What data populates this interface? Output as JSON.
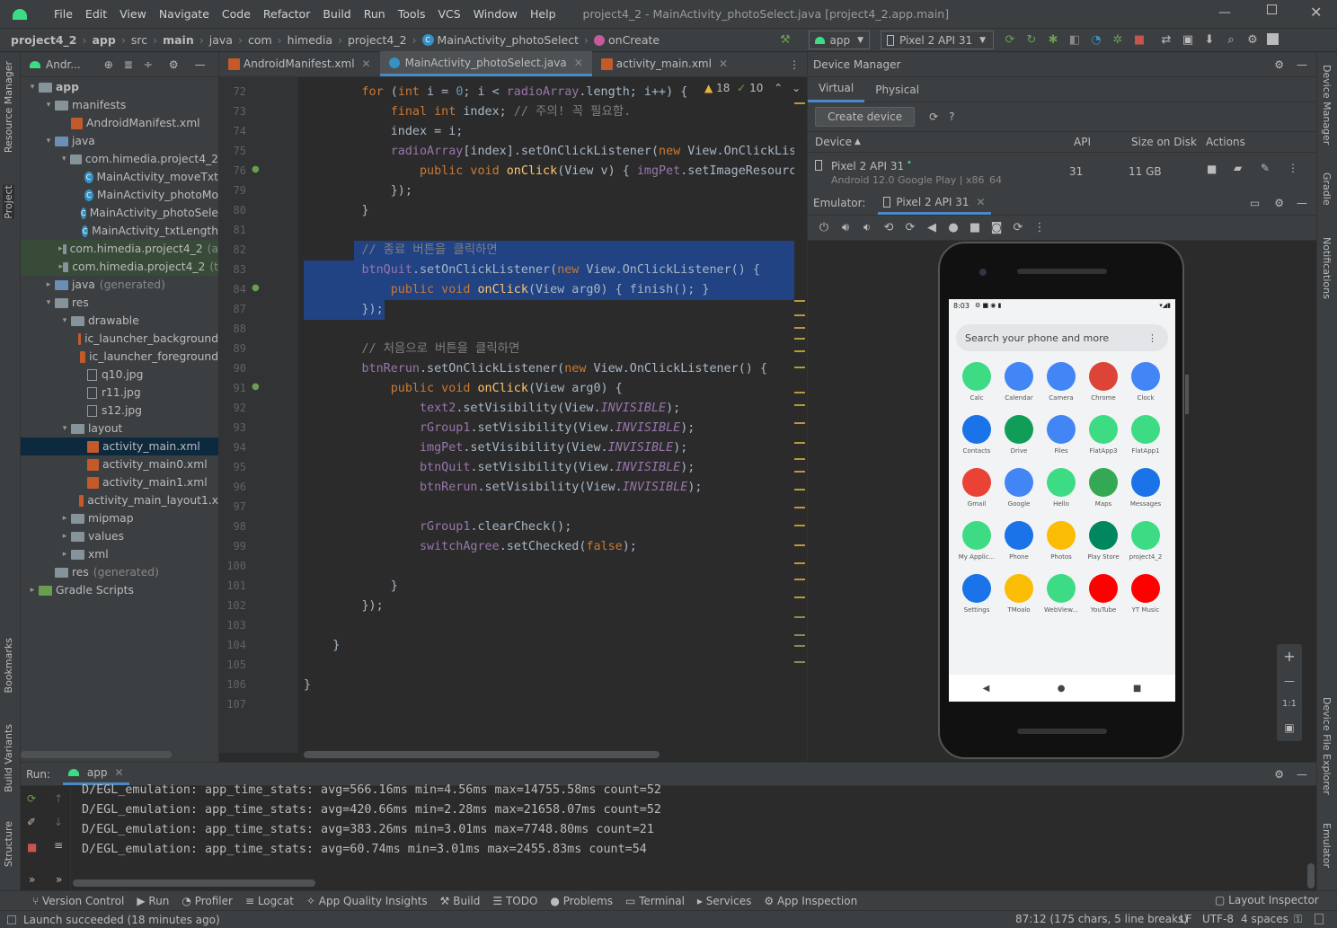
{
  "window": {
    "menu": [
      "File",
      "Edit",
      "View",
      "Navigate",
      "Code",
      "Refactor",
      "Build",
      "Run",
      "Tools",
      "VCS",
      "Window",
      "Help"
    ],
    "title": "project4_2 - MainActivity_photoSelect.java [project4_2.app.main]"
  },
  "nav": {
    "crumbs": [
      "project4_2",
      "app",
      "src",
      "main",
      "java",
      "com",
      "himedia",
      "project4_2",
      "MainActivity_photoSelect",
      "onCreate"
    ],
    "run_config": "app",
    "device": "Pixel 2 API 31"
  },
  "project": {
    "header": "Andr...",
    "tree": [
      {
        "label": "app",
        "indent": 0,
        "arrow": "▾",
        "icon": "folder",
        "bold": true
      },
      {
        "label": "manifests",
        "indent": 1,
        "arrow": "▾",
        "icon": "folder"
      },
      {
        "label": "AndroidManifest.xml",
        "indent": 2,
        "arrow": "",
        "icon": "xml"
      },
      {
        "label": "java",
        "indent": 1,
        "arrow": "▾",
        "icon": "jfolder"
      },
      {
        "label": "com.himedia.project4_2",
        "indent": 2,
        "arrow": "▾",
        "icon": "folder"
      },
      {
        "label": "MainActivity_moveTxt",
        "indent": 3,
        "arrow": "",
        "icon": "class"
      },
      {
        "label": "MainActivity_photoMo",
        "indent": 3,
        "arrow": "",
        "icon": "class"
      },
      {
        "label": "MainActivity_photoSele",
        "indent": 3,
        "arrow": "",
        "icon": "class"
      },
      {
        "label": "MainActivity_txtLength",
        "indent": 3,
        "arrow": "",
        "icon": "class"
      },
      {
        "label": "com.himedia.project4_2",
        "indent": 2,
        "arrow": "▸",
        "icon": "folder",
        "hl": true,
        "suffix": "(a"
      },
      {
        "label": "com.himedia.project4_2",
        "indent": 2,
        "arrow": "▸",
        "icon": "folder",
        "hl": true,
        "suffix": "(t"
      },
      {
        "label": "java",
        "indent": 1,
        "arrow": "▸",
        "icon": "jfolder",
        "suffix": "(generated)"
      },
      {
        "label": "res",
        "indent": 1,
        "arrow": "▾",
        "icon": "folder"
      },
      {
        "label": "drawable",
        "indent": 2,
        "arrow": "▾",
        "icon": "folder"
      },
      {
        "label": "ic_launcher_background",
        "indent": 3,
        "arrow": "",
        "icon": "xml"
      },
      {
        "label": "ic_launcher_foreground",
        "indent": 3,
        "arrow": "",
        "icon": "xml"
      },
      {
        "label": "q10.jpg",
        "indent": 3,
        "arrow": "",
        "icon": "img"
      },
      {
        "label": "r11.jpg",
        "indent": 3,
        "arrow": "",
        "icon": "img"
      },
      {
        "label": "s12.jpg",
        "indent": 3,
        "arrow": "",
        "icon": "img"
      },
      {
        "label": "layout",
        "indent": 2,
        "arrow": "▾",
        "icon": "folder"
      },
      {
        "label": "activity_main.xml",
        "indent": 3,
        "arrow": "",
        "icon": "xml",
        "selected": true
      },
      {
        "label": "activity_main0.xml",
        "indent": 3,
        "arrow": "",
        "icon": "xml"
      },
      {
        "label": "activity_main1.xml",
        "indent": 3,
        "arrow": "",
        "icon": "xml"
      },
      {
        "label": "activity_main_layout1.x",
        "indent": 3,
        "arrow": "",
        "icon": "xml"
      },
      {
        "label": "mipmap",
        "indent": 2,
        "arrow": "▸",
        "icon": "folder"
      },
      {
        "label": "values",
        "indent": 2,
        "arrow": "▸",
        "icon": "folder"
      },
      {
        "label": "xml",
        "indent": 2,
        "arrow": "▸",
        "icon": "folder"
      },
      {
        "label": "res",
        "indent": 1,
        "arrow": "",
        "icon": "folder",
        "suffix": "(generated)"
      },
      {
        "label": "Gradle Scripts",
        "indent": 0,
        "arrow": "▸",
        "icon": "gradle"
      }
    ]
  },
  "editor": {
    "tabs": [
      "AndroidManifest.xml",
      "MainActivity_photoSelect.java",
      "activity_main.xml"
    ],
    "active_tab": 1,
    "warnings": "18",
    "weak": "10",
    "lines": [
      {
        "n": "72",
        "html": "        <span class='kw'>for</span> (<span class='kw'>int</span> i = <span class='num'>0</span>; i &lt; <span class='fld'>radioArray</span>.length; i++) {"
      },
      {
        "n": "73",
        "html": "            <span class='kw'>final int</span> index; <span class='cm'>// 주의! 꼭 필요함.</span>"
      },
      {
        "n": "74",
        "html": "            index = i;"
      },
      {
        "n": "75",
        "html": "            <span class='fld'>radioArray</span>[index].setOnClickListener(<span class='kw'>new</span> View.OnClickListe"
      },
      {
        "n": "76",
        "html": "                <span class='kw'>public void</span> <span class='fn'>onClick</span>(View v) { <span class='fld'>imgPet</span>.setImageResource("
      },
      {
        "n": "79",
        "html": "            });"
      },
      {
        "n": "80",
        "html": "        }"
      },
      {
        "n": "81",
        "html": ""
      },
      {
        "n": "82",
        "html": "        <span class='cm'>// 종료 버튼을 클릭하면</span>"
      },
      {
        "n": "83",
        "html": "        <span class='fld'>btnQuit</span>.setOnClickListener(<span class='kw'>new</span> View.OnClickListener() {"
      },
      {
        "n": "84",
        "html": "            <span class='kw'>public void</span> <span class='fn'>onClick</span>(View arg0) { finish(); }"
      },
      {
        "n": "87",
        "html": "        });"
      },
      {
        "n": "88",
        "html": ""
      },
      {
        "n": "89",
        "html": "        <span class='cm'>// 처음으로 버튼을 클릭하면</span>"
      },
      {
        "n": "90",
        "html": "        <span class='fld'>btnRerun</span>.setOnClickListener(<span class='kw'>new</span> View.OnClickListener() {"
      },
      {
        "n": "91",
        "html": "            <span class='kw'>public void</span> <span class='fn'>onClick</span>(View arg0) {"
      },
      {
        "n": "92",
        "html": "                <span class='fld'>text2</span>.setVisibility(View.<span class='it'>INVISIBLE</span>);"
      },
      {
        "n": "93",
        "html": "                <span class='fld'>rGroup1</span>.setVisibility(View.<span class='it'>INVISIBLE</span>);"
      },
      {
        "n": "94",
        "html": "                <span class='fld'>imgPet</span>.setVisibility(View.<span class='it'>INVISIBLE</span>);"
      },
      {
        "n": "95",
        "html": "                <span class='fld'>btnQuit</span>.setVisibility(View.<span class='it'>INVISIBLE</span>);"
      },
      {
        "n": "96",
        "html": "                <span class='fld'>btnRerun</span>.setVisibility(View.<span class='it'>INVISIBLE</span>);"
      },
      {
        "n": "97",
        "html": ""
      },
      {
        "n": "98",
        "html": "                <span class='fld'>rGroup1</span>.clearCheck();"
      },
      {
        "n": "99",
        "html": "                <span class='fld'>switchAgree</span>.setChecked(<span class='kw'>false</span>);"
      },
      {
        "n": "100",
        "html": ""
      },
      {
        "n": "101",
        "html": "            }"
      },
      {
        "n": "102",
        "html": "        });"
      },
      {
        "n": "103",
        "html": ""
      },
      {
        "n": "104",
        "html": "    }"
      },
      {
        "n": "105",
        "html": ""
      },
      {
        "n": "106",
        "html": "}"
      },
      {
        "n": "107",
        "html": ""
      }
    ]
  },
  "device_manager": {
    "title": "Device Manager",
    "tabs": [
      "Virtual",
      "Physical"
    ],
    "create": "Create device",
    "cols": [
      "Device",
      "API",
      "Size on Disk",
      "Actions"
    ],
    "row": {
      "name": "Pixel 2 API 31",
      "sub": "Android 12.0 Google Play | x86_64",
      "api": "31",
      "size": "11 GB"
    }
  },
  "emulator": {
    "label": "Emulator:",
    "tab": "Pixel 2 API 31",
    "time": "8:03",
    "search": "Search your phone and more",
    "zoom_label": "1:1",
    "apps": [
      {
        "n": "Calc",
        "c": "#3ddc84"
      },
      {
        "n": "Calendar",
        "c": "#4285f4"
      },
      {
        "n": "Camera",
        "c": "#4285f4"
      },
      {
        "n": "Chrome",
        "c": "#db4437"
      },
      {
        "n": "Clock",
        "c": "#4285f4"
      },
      {
        "n": "Contacts",
        "c": "#1a73e8"
      },
      {
        "n": "Drive",
        "c": "#0f9d58"
      },
      {
        "n": "Files",
        "c": "#4285f4"
      },
      {
        "n": "FlatApp3",
        "c": "#3ddc84"
      },
      {
        "n": "FlatApp1",
        "c": "#3ddc84"
      },
      {
        "n": "Gmail",
        "c": "#ea4335"
      },
      {
        "n": "Google",
        "c": "#4285f4"
      },
      {
        "n": "Hello",
        "c": "#3ddc84"
      },
      {
        "n": "Maps",
        "c": "#34a853"
      },
      {
        "n": "Messages",
        "c": "#1a73e8"
      },
      {
        "n": "My Applic...",
        "c": "#3ddc84"
      },
      {
        "n": "Phone",
        "c": "#1a73e8"
      },
      {
        "n": "Photos",
        "c": "#fbbc04"
      },
      {
        "n": "Play Store",
        "c": "#01875f"
      },
      {
        "n": "project4_2",
        "c": "#3ddc84"
      },
      {
        "n": "Settings",
        "c": "#1a73e8"
      },
      {
        "n": "TMoalo",
        "c": "#fbbc04"
      },
      {
        "n": "WebView...",
        "c": "#3ddc84"
      },
      {
        "n": "YouTube",
        "c": "#ff0000"
      },
      {
        "n": "YT Music",
        "c": "#ff0000"
      }
    ]
  },
  "run": {
    "label": "Run:",
    "config": "app",
    "log": [
      "D/EGL_emulation: app_time_stats: avg=566.16ms min=4.56ms max=14755.58ms count=52",
      "D/EGL_emulation: app_time_stats: avg=420.66ms min=2.28ms max=21658.07ms count=52",
      "D/EGL_emulation: app_time_stats: avg=383.26ms min=3.01ms max=7748.80ms count=21",
      "D/EGL_emulation: app_time_stats: avg=60.74ms min=3.01ms max=2455.83ms count=54"
    ]
  },
  "toolwindows": [
    "Version Control",
    "Run",
    "Profiler",
    "Logcat",
    "App Quality Insights",
    "Build",
    "TODO",
    "Problems",
    "Terminal",
    "Services",
    "App Inspection"
  ],
  "layout_inspector": "Layout Inspector",
  "status": {
    "message": "Launch succeeded (18 minutes ago)",
    "pos": "87:12 (175 chars, 5 line breaks)",
    "lf": "LF",
    "enc": "UTF-8",
    "indent": "4 spaces"
  },
  "side_left": [
    "Resource Manager",
    "Project",
    "Bookmarks",
    "Build Variants",
    "Structure"
  ],
  "side_right": [
    "Device Manager",
    "Gradle",
    "Notifications",
    "Device File Explorer",
    "Emulator"
  ]
}
